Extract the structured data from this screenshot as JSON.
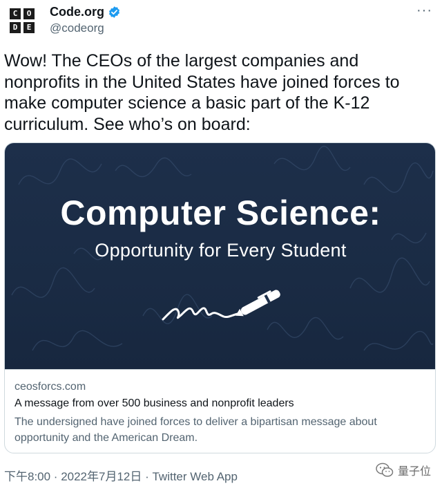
{
  "account": {
    "display_name": "Code.org",
    "handle": "@codeorg",
    "logo_letters": [
      "C",
      "O",
      "D",
      "E"
    ]
  },
  "tweet": {
    "text": "Wow! The CEOs of the largest companies and nonprofits in the United States have joined forces to make computer science a basic part of the K-12 curriculum. See who’s on board:"
  },
  "card": {
    "image_title": "Computer Science:",
    "image_subtitle": "Opportunity for Every Student",
    "domain": "ceosforcs.com",
    "headline": "A message from over 500 business and nonprofit leaders",
    "description": "The undersigned have joined forces to deliver a bipartisan message about opportunity and the American Dream."
  },
  "footer": {
    "timestamp": "下午8:00 · 2022年7月12日 · Twitter Web App"
  },
  "watermark": {
    "text": "量子位"
  },
  "colors": {
    "text_primary": "#0f1419",
    "text_secondary": "#536471",
    "card_border": "#cfd9de",
    "card_image_bg": "#1d2f4a",
    "verified_blue": "#1d9bf0"
  },
  "icons": [
    "verified-badge-icon",
    "more-options-icon",
    "pen-icon",
    "wechat-icon"
  ]
}
